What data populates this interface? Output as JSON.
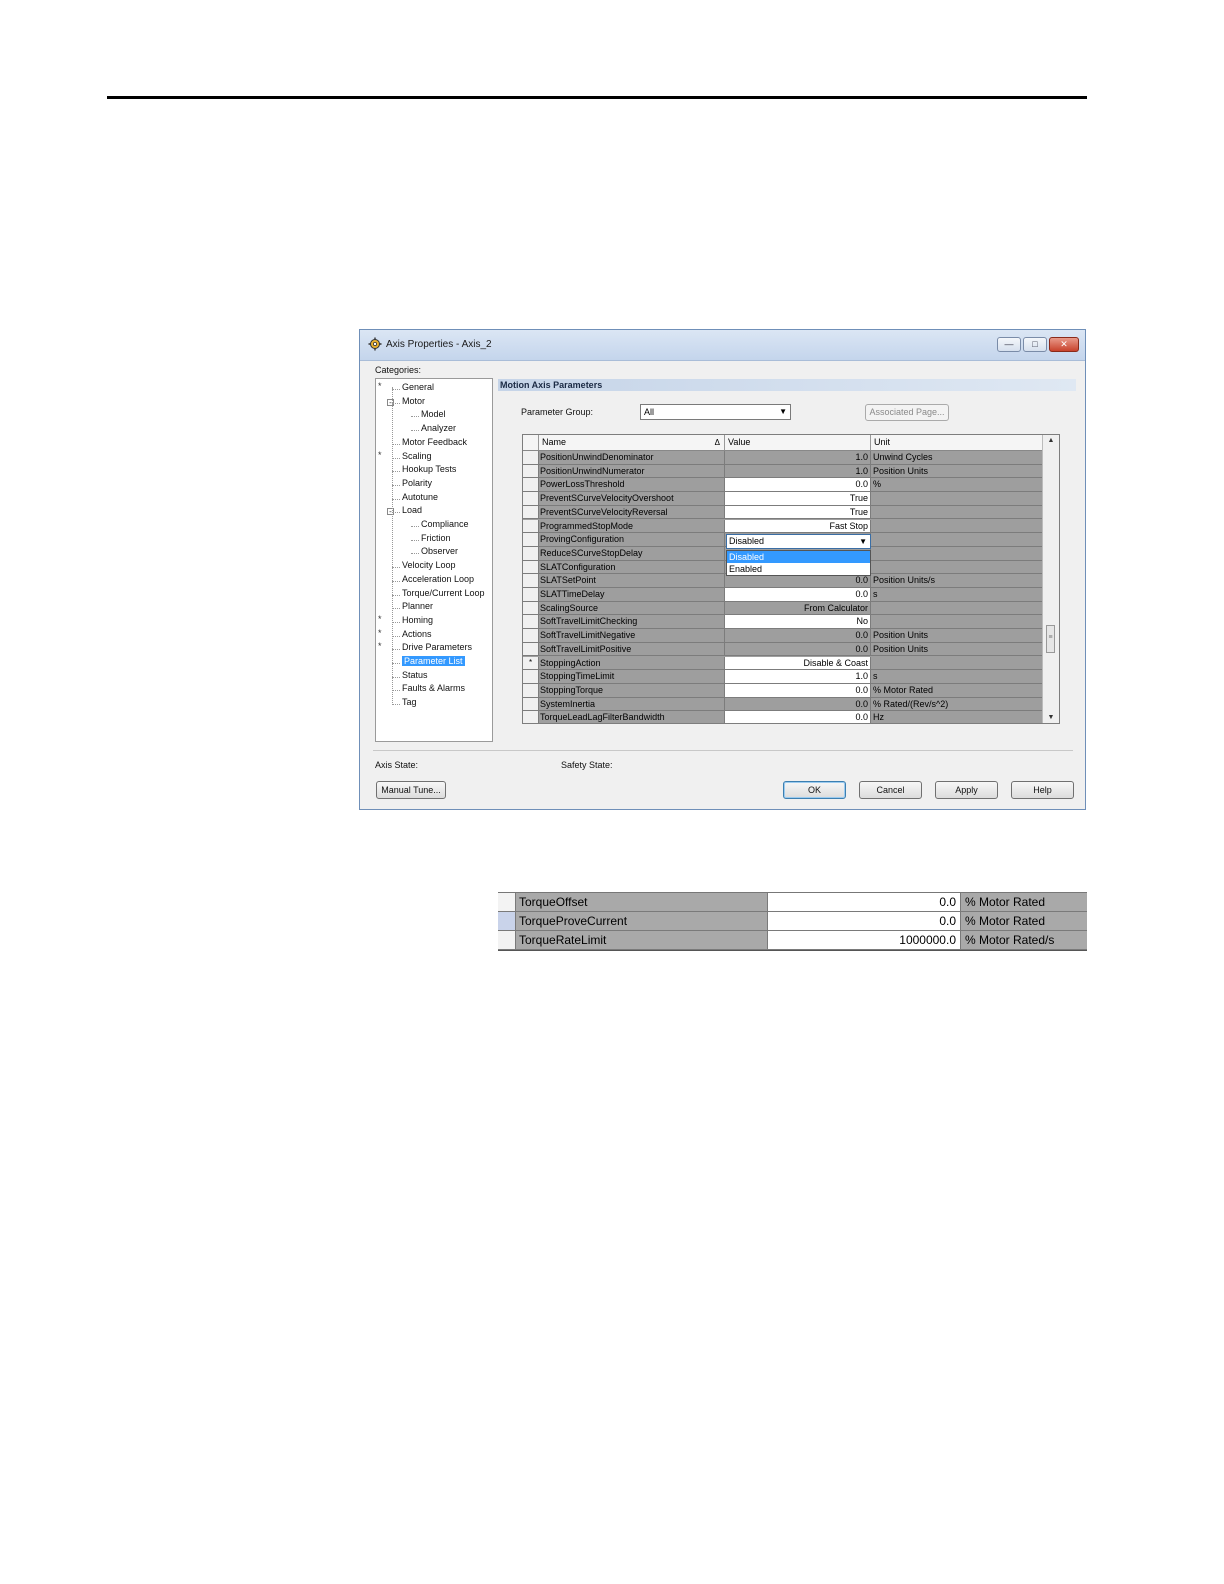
{
  "window": {
    "title": "Axis Properties - Axis_2"
  },
  "categories_label": "Categories:",
  "tree": [
    {
      "label": "General",
      "level": 0,
      "mark": "*"
    },
    {
      "label": "Motor",
      "level": 0,
      "expander": "-"
    },
    {
      "label": "Model",
      "level": 1
    },
    {
      "label": "Analyzer",
      "level": 1
    },
    {
      "label": "Motor Feedback",
      "level": 0
    },
    {
      "label": "Scaling",
      "level": 0,
      "mark": "*"
    },
    {
      "label": "Hookup Tests",
      "level": 0
    },
    {
      "label": "Polarity",
      "level": 0
    },
    {
      "label": "Autotune",
      "level": 0
    },
    {
      "label": "Load",
      "level": 0,
      "expander": "-"
    },
    {
      "label": "Compliance",
      "level": 1
    },
    {
      "label": "Friction",
      "level": 1
    },
    {
      "label": "Observer",
      "level": 1
    },
    {
      "label": "Velocity Loop",
      "level": 0
    },
    {
      "label": "Acceleration Loop",
      "level": 0
    },
    {
      "label": "Torque/Current Loop",
      "level": 0
    },
    {
      "label": "Planner",
      "level": 0
    },
    {
      "label": "Homing",
      "level": 0,
      "mark": "*"
    },
    {
      "label": "Actions",
      "level": 0,
      "mark": "*"
    },
    {
      "label": "Drive Parameters",
      "level": 0,
      "mark": "*"
    },
    {
      "label": "Parameter List",
      "level": 0,
      "selected": true
    },
    {
      "label": "Status",
      "level": 0
    },
    {
      "label": "Faults & Alarms",
      "level": 0
    },
    {
      "label": "Tag",
      "level": 0
    }
  ],
  "section_title": "Motion Axis Parameters",
  "parameter_group": {
    "label": "Parameter Group:",
    "value": "All"
  },
  "associated_page_label": "Associated Page...",
  "grid": {
    "headers": [
      "Name",
      "Value",
      "Unit"
    ],
    "sort_indicator": "Δ",
    "rows": [
      {
        "mark": "",
        "name": "PositionUnwindDenominator",
        "value": "1.0",
        "unit": "Unwind Cycles",
        "editable": false
      },
      {
        "mark": "",
        "name": "PositionUnwindNumerator",
        "value": "1.0",
        "unit": "Position Units",
        "editable": false
      },
      {
        "mark": "",
        "name": "PowerLossThreshold",
        "value": "0.0",
        "unit": "%",
        "editable": true
      },
      {
        "mark": "",
        "name": "PreventSCurveVelocityOvershoot",
        "value": "True",
        "unit": "",
        "editable": true
      },
      {
        "mark": "",
        "name": "PreventSCurveVelocityReversal",
        "value": "True",
        "unit": "",
        "editable": true
      },
      {
        "mark": "",
        "name": "ProgrammedStopMode",
        "value": "Fast Stop",
        "unit": "",
        "editable": true
      },
      {
        "mark": "",
        "name": "ProvingConfiguration",
        "value": "",
        "unit": "",
        "editable": false
      },
      {
        "mark": "",
        "name": "ReduceSCurveStopDelay",
        "value": "",
        "unit": "",
        "editable": false
      },
      {
        "mark": "",
        "name": "SLATConfiguration",
        "value": "",
        "unit": "",
        "editable": false
      },
      {
        "mark": "",
        "name": "SLATSetPoint",
        "value": "0.0",
        "unit": "Position Units/s",
        "editable": false
      },
      {
        "mark": "",
        "name": "SLATTimeDelay",
        "value": "0.0",
        "unit": "s",
        "editable": true
      },
      {
        "mark": "",
        "name": "ScalingSource",
        "value": "From Calculator",
        "unit": "",
        "editable": false
      },
      {
        "mark": "",
        "name": "SoftTravelLimitChecking",
        "value": "No",
        "unit": "",
        "editable": true
      },
      {
        "mark": "",
        "name": "SoftTravelLimitNegative",
        "value": "0.0",
        "unit": "Position Units",
        "editable": false
      },
      {
        "mark": "",
        "name": "SoftTravelLimitPositive",
        "value": "0.0",
        "unit": "Position Units",
        "editable": false
      },
      {
        "mark": "*",
        "name": "StoppingAction",
        "value": "Disable & Coast",
        "unit": "",
        "editable": true
      },
      {
        "mark": "",
        "name": "StoppingTimeLimit",
        "value": "1.0",
        "unit": "s",
        "editable": true
      },
      {
        "mark": "",
        "name": "StoppingTorque",
        "value": "0.0",
        "unit": "% Motor Rated",
        "editable": true
      },
      {
        "mark": "",
        "name": "SystemInertia",
        "value": "0.0",
        "unit": "% Rated/(Rev/s^2)",
        "editable": false
      },
      {
        "mark": "",
        "name": "TorqueLeadLagFilterBandwidth",
        "value": "0.0",
        "unit": "Hz",
        "editable": true
      }
    ]
  },
  "dropdown": {
    "current": "Disabled",
    "options": [
      "Disabled",
      "Enabled"
    ],
    "highlighted": 0
  },
  "axis_state_label": "Axis State:",
  "safety_state_label": "Safety State:",
  "buttons": {
    "manual_tune": "Manual Tune...",
    "ok": "OK",
    "cancel": "Cancel",
    "apply": "Apply",
    "help": "Help"
  },
  "zoom_table": [
    {
      "name": "TorqueOffset",
      "value": "0.0",
      "unit": "% Motor Rated",
      "highlight": false
    },
    {
      "name": "TorqueProveCurrent",
      "value": "0.0",
      "unit": "% Motor Rated",
      "highlight": true
    },
    {
      "name": "TorqueRateLimit",
      "value": "1000000.0",
      "unit": "% Motor Rated/s",
      "highlight": false
    }
  ]
}
